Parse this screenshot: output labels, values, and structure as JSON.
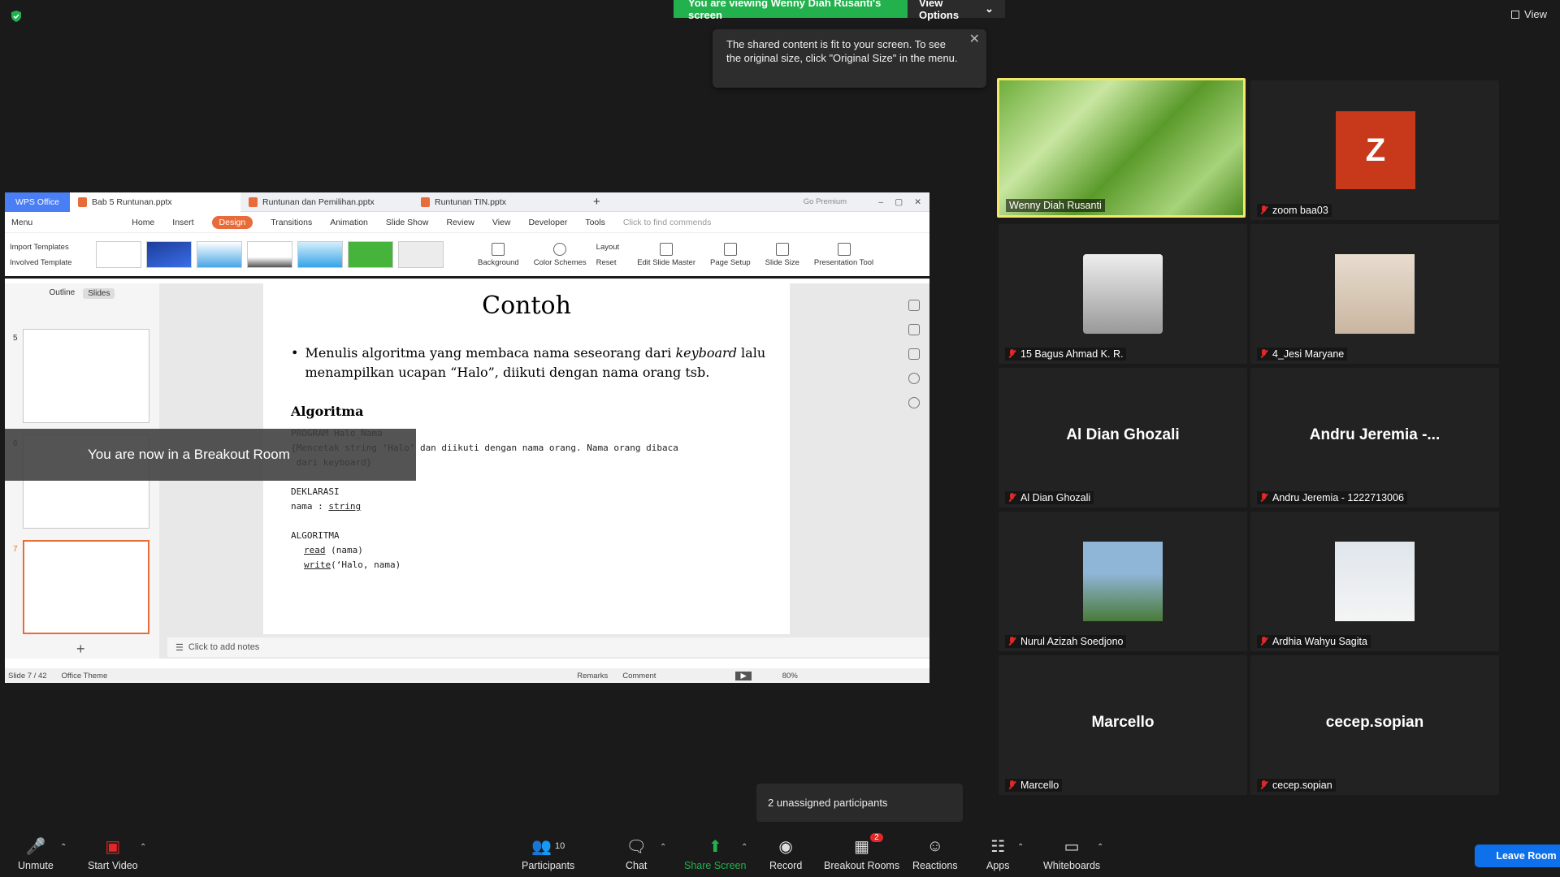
{
  "banner": {
    "viewing": "You are viewing Wenny Diah Rusanti's screen",
    "view_options": "View Options"
  },
  "tooltip": {
    "text": "The shared content is fit to your screen. To see the original size, click \"Original Size\" in the menu."
  },
  "top_view": "View",
  "wps": {
    "logo": "WPS Office",
    "tabs": [
      "Bab 5 Runtunan.pptx",
      "Runtunan dan Pemilihan.pptx",
      "Runtunan TIN.pptx"
    ],
    "menu": "Menu",
    "ribbon_tabs": [
      "Home",
      "Insert",
      "Design",
      "Transitions",
      "Animation",
      "Slide Show",
      "Review",
      "View",
      "Developer",
      "Tools"
    ],
    "find_commands": "Click to find commends",
    "go_premium": "Go Premium",
    "import_templates": "Import Templates",
    "involved_template": "Involved Template",
    "ribbon_buttons": [
      "Background",
      "Color Schemes",
      "Layout",
      "Reset",
      "Edit Slide Master",
      "Page Setup",
      "Slide Size",
      "Presentation Tool"
    ],
    "pane_tabs": [
      "Outline",
      "Slides"
    ],
    "slide_numbers": [
      "5",
      "6",
      "7"
    ],
    "slide": {
      "title": "Contoh",
      "bullet_pre": "Menulis algoritma yang membaca nama seseorang dari ",
      "bullet_em": "keyboard",
      "bullet_post": " lalu menampilkan ucapan “Halo”, diikuti dengan nama orang tsb.",
      "algo_title": "Algoritma",
      "code_1": "PROGRAM Halo_Nama",
      "code_2": "{Mencetak string ‘Halo’ dan diikuti dengan nama orang. Nama orang dibaca",
      "code_3": " dari keyboard}",
      "code_4": "DEKLARASI",
      "code_5a": "nama : ",
      "code_5b": "string",
      "code_6": "ALGORITMA",
      "code_7a": "read",
      "code_7b": " (nama)",
      "code_8a": "write",
      "code_8b": "(‘Halo, nama)"
    },
    "notes": "Click to add notes",
    "status": {
      "slide": "Slide 7 / 42",
      "theme": "Office Theme",
      "remarks": "Remarks",
      "comment": "Comment",
      "zoom": "80%"
    }
  },
  "breakout_overlay": "You are now in a Breakout Room",
  "participants": [
    {
      "name": "Wenny Diah Rusanti"
    },
    {
      "name": "zoom baa03",
      "initial": "Z"
    },
    {
      "name": "15 Bagus Ahmad K. R."
    },
    {
      "name": "4_Jesi Maryane"
    },
    {
      "name": "Al Dian Ghozali",
      "big": "Al Dian Ghozali"
    },
    {
      "name": "Andru Jeremia - 1222713006",
      "big": "Andru Jeremia -..."
    },
    {
      "name": "Nurul Azizah Soedjono"
    },
    {
      "name": "Ardhia Wahyu Sagita"
    },
    {
      "name": "Marcello",
      "big": "Marcello"
    },
    {
      "name": "cecep.sopian",
      "big": "cecep.sopian"
    }
  ],
  "unassigned": "2 unassigned participants",
  "toolbar": {
    "unmute": "Unmute",
    "start_video": "Start Video",
    "participants": "Participants",
    "participants_count": "10",
    "chat": "Chat",
    "share_screen": "Share Screen",
    "record": "Record",
    "breakout_rooms": "Breakout Rooms",
    "breakout_badge": "2",
    "reactions": "Reactions",
    "apps": "Apps",
    "whiteboards": "Whiteboards",
    "leave_room": "Leave Room"
  },
  "colors": {
    "share_green": "#23b14d",
    "active_speaker": "#f3e86b",
    "leave_blue": "#0e71eb",
    "muted_red": "#e02828",
    "wps_accent": "#e86b3a"
  }
}
